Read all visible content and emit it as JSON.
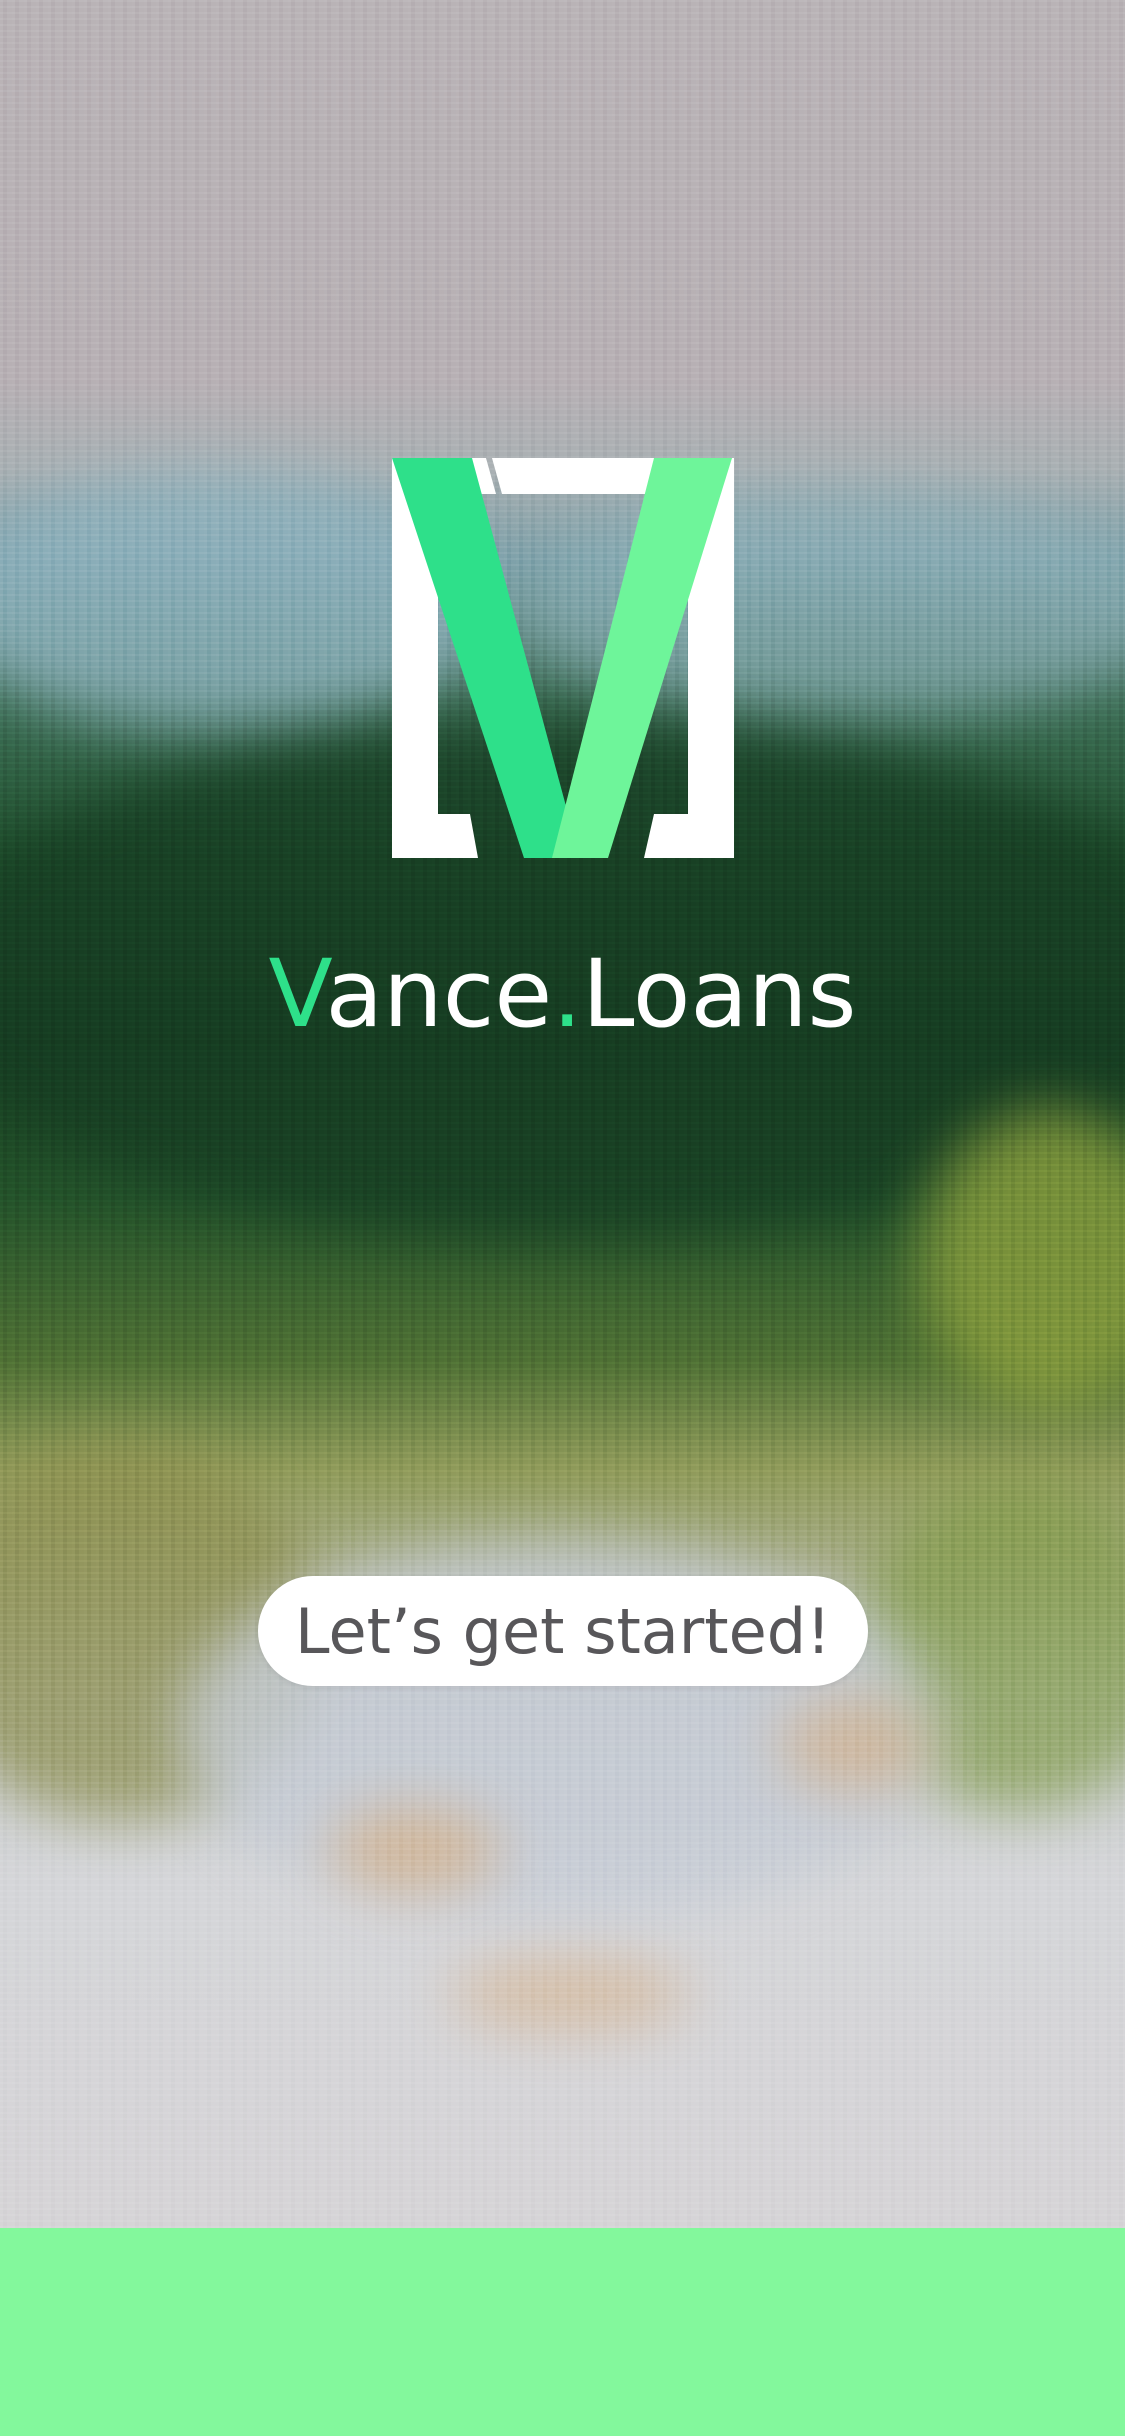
{
  "app": {
    "brand_prefix": "V",
    "brand_middle": "ance",
    "brand_dot": ".",
    "brand_suffix": "Loans"
  },
  "logo": {
    "icon": "vance-logo-icon"
  },
  "cta": {
    "label": "Let’s get started!"
  },
  "colors": {
    "accent": "#2ee08a",
    "accent_light": "#6ef59a",
    "footer": "#83f89c",
    "button_bg": "#ffffff",
    "button_text": "#58575a"
  }
}
